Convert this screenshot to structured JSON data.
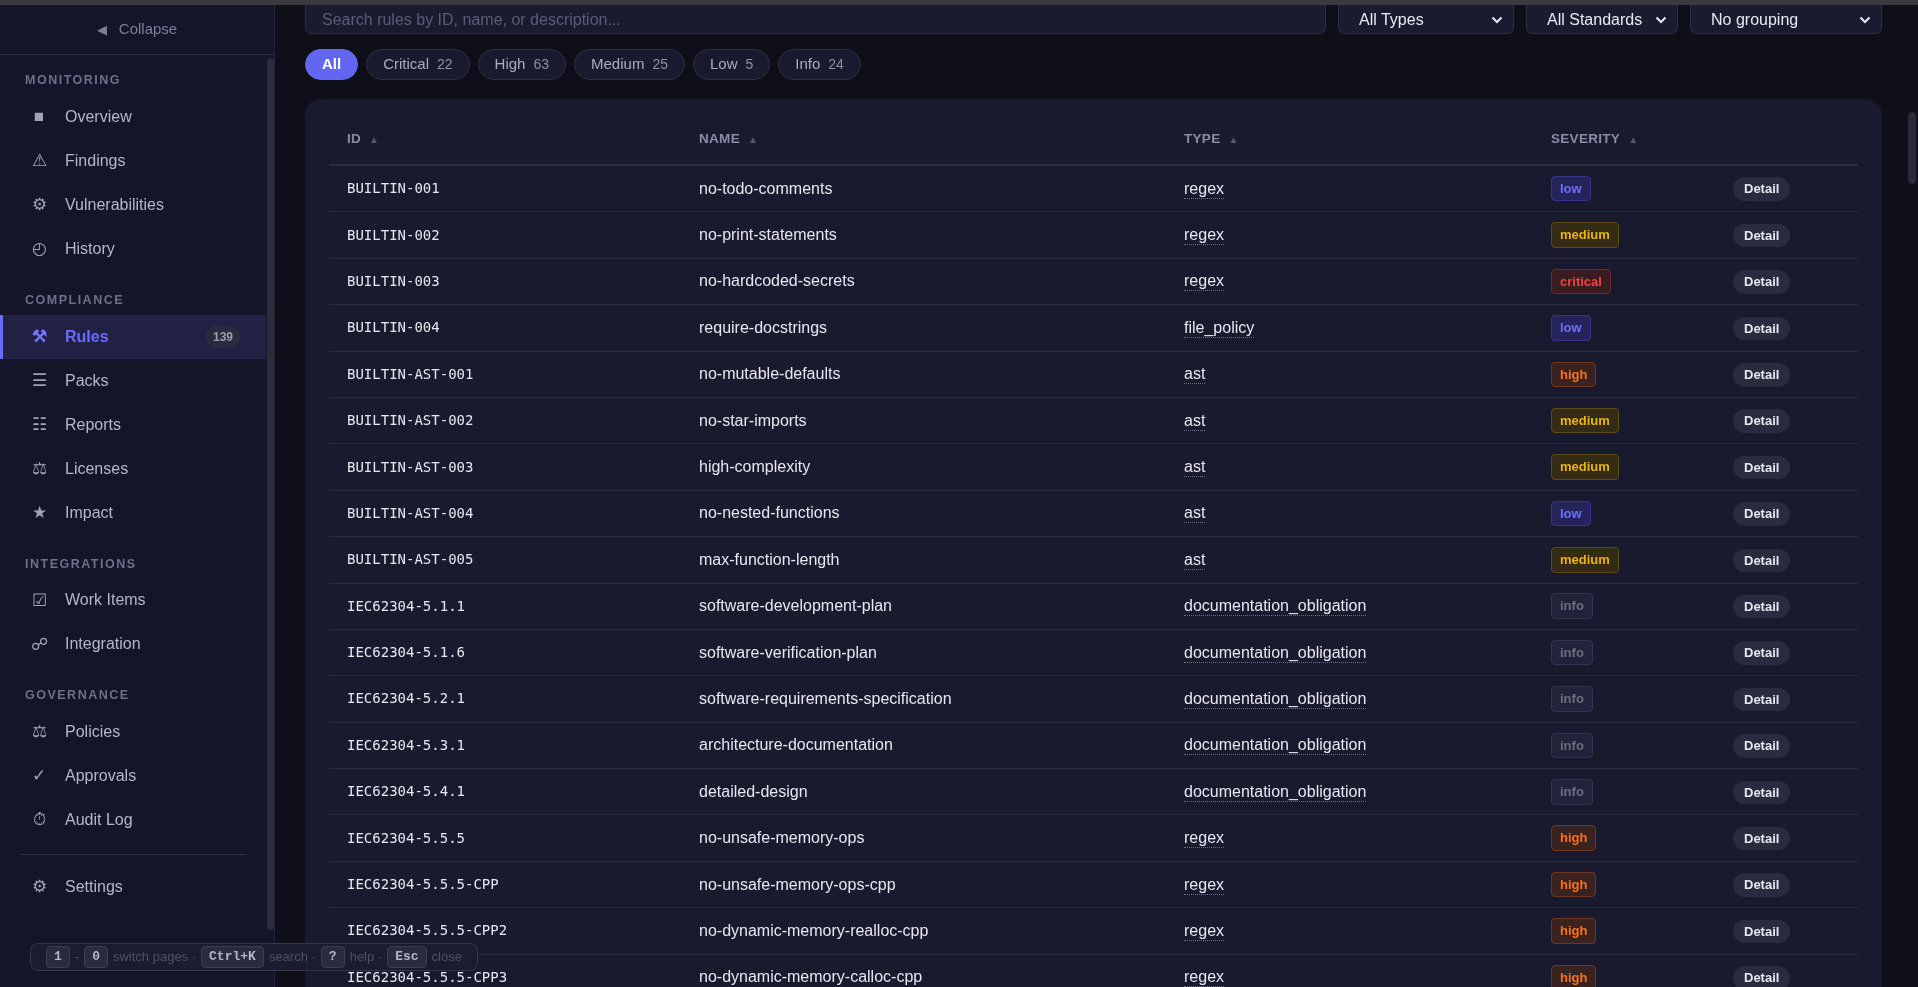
{
  "sidebar": {
    "collapse": {
      "icon": "◀",
      "label": "Collapse"
    },
    "sections": [
      {
        "title": "MONITORING",
        "items": [
          {
            "icon": "■",
            "label": "Overview",
            "selected": false
          },
          {
            "icon": "⚠",
            "label": "Findings",
            "selected": false
          },
          {
            "icon": "⚙",
            "label": "Vulnerabilities",
            "selected": false
          },
          {
            "icon": "◴",
            "label": "History",
            "selected": false
          }
        ]
      },
      {
        "title": "COMPLIANCE",
        "items": [
          {
            "icon": "⚒",
            "label": "Rules",
            "selected": true,
            "count": "139"
          },
          {
            "icon": "☰",
            "label": "Packs",
            "selected": false
          },
          {
            "icon": "☷",
            "label": "Reports",
            "selected": false
          },
          {
            "icon": "⚖",
            "label": "Licenses",
            "selected": false
          },
          {
            "icon": "★",
            "label": "Impact",
            "selected": false
          }
        ]
      },
      {
        "title": "INTEGRATIONS",
        "items": [
          {
            "icon": "☑",
            "label": "Work Items",
            "selected": false
          },
          {
            "icon": "☍",
            "label": "Integration",
            "selected": false
          }
        ]
      },
      {
        "title": "GOVERNANCE",
        "items": [
          {
            "icon": "⚖",
            "label": "Policies",
            "selected": false
          },
          {
            "icon": "✓",
            "label": "Approvals",
            "selected": false
          },
          {
            "icon": "⏱",
            "label": "Audit Log",
            "selected": false
          }
        ]
      }
    ],
    "footer_items": [
      {
        "icon": "⚙",
        "label": "Settings",
        "selected": false
      }
    ]
  },
  "search": {
    "placeholder": "Search rules by ID, name, or description..."
  },
  "filters": [
    {
      "value": "All Types"
    },
    {
      "value": "All Standards"
    },
    {
      "value": "No grouping"
    }
  ],
  "severity_chips": [
    {
      "label": "All",
      "selected": true
    },
    {
      "label": "Critical",
      "count": "22",
      "selected": false
    },
    {
      "label": "High",
      "count": "63",
      "selected": false
    },
    {
      "label": "Medium",
      "count": "25",
      "selected": false
    },
    {
      "label": "Low",
      "count": "5",
      "selected": false
    },
    {
      "label": "Info",
      "count": "24",
      "selected": false
    }
  ],
  "table": {
    "columns": [
      {
        "label": "ID",
        "sort": "▲"
      },
      {
        "label": "NAME",
        "sort": "▲"
      },
      {
        "label": "TYPE",
        "sort": "▲"
      },
      {
        "label": "SEVERITY",
        "sort": "▲"
      }
    ],
    "rows": [
      {
        "id": "BUILTIN-001",
        "name": "no-todo-comments",
        "type": "regex",
        "severity": "low",
        "action": "Detail"
      },
      {
        "id": "BUILTIN-002",
        "name": "no-print-statements",
        "type": "regex",
        "severity": "medium",
        "action": "Detail"
      },
      {
        "id": "BUILTIN-003",
        "name": "no-hardcoded-secrets",
        "type": "regex",
        "severity": "critical",
        "action": "Detail"
      },
      {
        "id": "BUILTIN-004",
        "name": "require-docstrings",
        "type": "file_policy",
        "severity": "low",
        "action": "Detail"
      },
      {
        "id": "BUILTIN-AST-001",
        "name": "no-mutable-defaults",
        "type": "ast",
        "severity": "high",
        "action": "Detail"
      },
      {
        "id": "BUILTIN-AST-002",
        "name": "no-star-imports",
        "type": "ast",
        "severity": "medium",
        "action": "Detail"
      },
      {
        "id": "BUILTIN-AST-003",
        "name": "high-complexity",
        "type": "ast",
        "severity": "medium",
        "action": "Detail"
      },
      {
        "id": "BUILTIN-AST-004",
        "name": "no-nested-functions",
        "type": "ast",
        "severity": "low",
        "action": "Detail"
      },
      {
        "id": "BUILTIN-AST-005",
        "name": "max-function-length",
        "type": "ast",
        "severity": "medium",
        "action": "Detail"
      },
      {
        "id": "IEC62304-5.1.1",
        "name": "software-development-plan",
        "type": "documentation_obligation",
        "severity": "info",
        "action": "Detail"
      },
      {
        "id": "IEC62304-5.1.6",
        "name": "software-verification-plan",
        "type": "documentation_obligation",
        "severity": "info",
        "action": "Detail"
      },
      {
        "id": "IEC62304-5.2.1",
        "name": "software-requirements-specification",
        "type": "documentation_obligation",
        "severity": "info",
        "action": "Detail"
      },
      {
        "id": "IEC62304-5.3.1",
        "name": "architecture-documentation",
        "type": "documentation_obligation",
        "severity": "info",
        "action": "Detail"
      },
      {
        "id": "IEC62304-5.4.1",
        "name": "detailed-design",
        "type": "documentation_obligation",
        "severity": "info",
        "action": "Detail"
      },
      {
        "id": "IEC62304-5.5.5",
        "name": "no-unsafe-memory-ops",
        "type": "regex",
        "severity": "high",
        "action": "Detail"
      },
      {
        "id": "IEC62304-5.5.5-CPP",
        "name": "no-unsafe-memory-ops-cpp",
        "type": "regex",
        "severity": "high",
        "action": "Detail"
      },
      {
        "id": "IEC62304-5.5.5-CPP2",
        "name": "no-dynamic-memory-realloc-cpp",
        "type": "regex",
        "severity": "high",
        "action": "Detail"
      },
      {
        "id": "IEC62304-5.5.5-CPP3",
        "name": "no-dynamic-memory-calloc-cpp",
        "type": "regex",
        "severity": "high",
        "action": "Detail"
      }
    ]
  },
  "shortcut_hint": [
    {
      "kind": "key",
      "text": "1"
    },
    {
      "kind": "text",
      "text": "-"
    },
    {
      "kind": "key",
      "text": "0"
    },
    {
      "kind": "text",
      "text": "switch pages ·"
    },
    {
      "kind": "key",
      "text": "Ctrl+K"
    },
    {
      "kind": "text",
      "text": "search ·"
    },
    {
      "kind": "key",
      "text": "?"
    },
    {
      "kind": "text",
      "text": "help ·"
    },
    {
      "kind": "key",
      "text": "Esc"
    },
    {
      "kind": "text",
      "text": "close"
    }
  ]
}
